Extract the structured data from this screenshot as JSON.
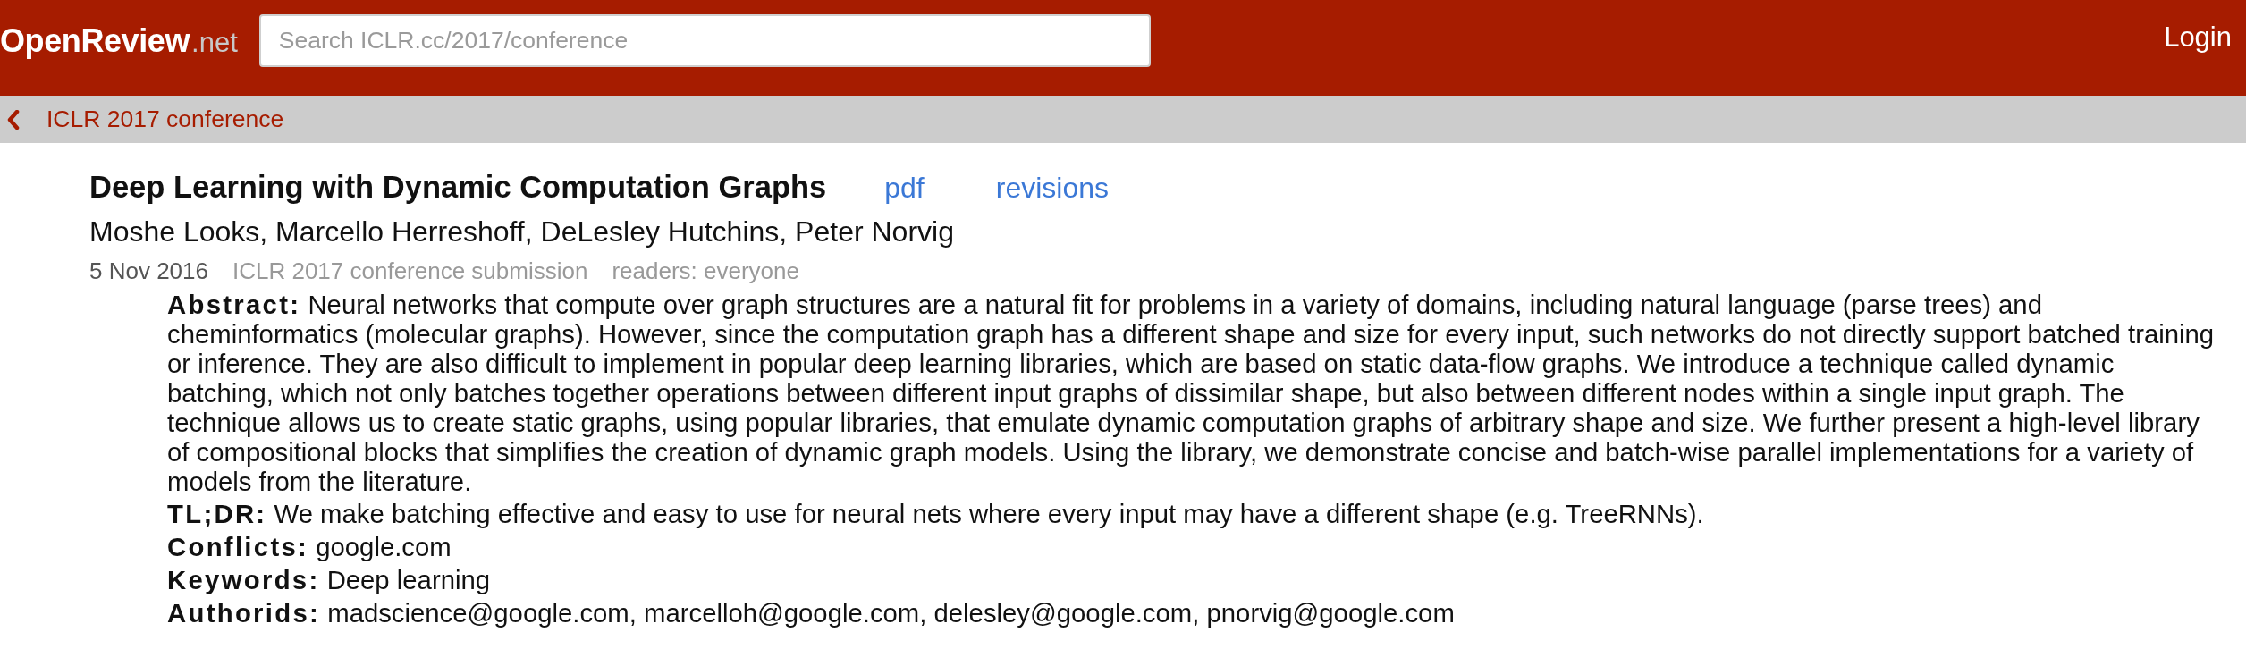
{
  "header": {
    "logo": {
      "name": "OpenReview",
      "suffix": ".net"
    },
    "search": {
      "placeholder": "Search ICLR.cc/2017/conference"
    },
    "login": "Login"
  },
  "breadcrumb": {
    "label": "ICLR 2017 conference"
  },
  "note": {
    "title": "Deep Learning with Dynamic Computation Graphs",
    "links": [
      {
        "label": "pdf"
      },
      {
        "label": "revisions"
      }
    ],
    "authors": "Moshe Looks, Marcello Herreshoff, DeLesley Hutchins, Peter Norvig",
    "meta": [
      {
        "kind": "date",
        "text": "5 Nov 2016"
      },
      {
        "kind": "venue",
        "text": "ICLR 2017 conference submission"
      },
      {
        "kind": "readers",
        "text": "readers: everyone"
      }
    ],
    "fields": [
      {
        "label": "Abstract:",
        "value": "Neural networks that compute over graph structures are a natural fit for problems in a variety of domains, including natural language (parse trees) and cheminformatics (molecular graphs). However, since the computation graph has a different shape and size for every input, such networks do not directly support batched training or inference. They are also difficult to implement in popular deep learning libraries, which are based on static data-flow graphs. We introduce a technique called dynamic batching, which not only batches together operations between different input graphs of dissimilar shape, but also between different nodes within a single input graph. The technique allows us to create static graphs, using popular libraries, that emulate dynamic computation graphs of arbitrary shape and size. We further present a high-level library of compositional blocks that simplifies the creation of dynamic graph models. Using the library, we demonstrate concise and batch-wise parallel implementations for a variety of models from the literature."
      },
      {
        "label": "TL;DR:",
        "value": "We make batching effective and easy to use for neural nets where every input may have a different shape (e.g. TreeRNNs)."
      },
      {
        "label": "Conflicts:",
        "value": "google.com"
      },
      {
        "label": "Keywords:",
        "value": "Deep learning"
      },
      {
        "label": "Authorids:",
        "value": "madscience@google.com, marcelloh@google.com, delesley@google.com, pnorvig@google.com"
      }
    ]
  }
}
